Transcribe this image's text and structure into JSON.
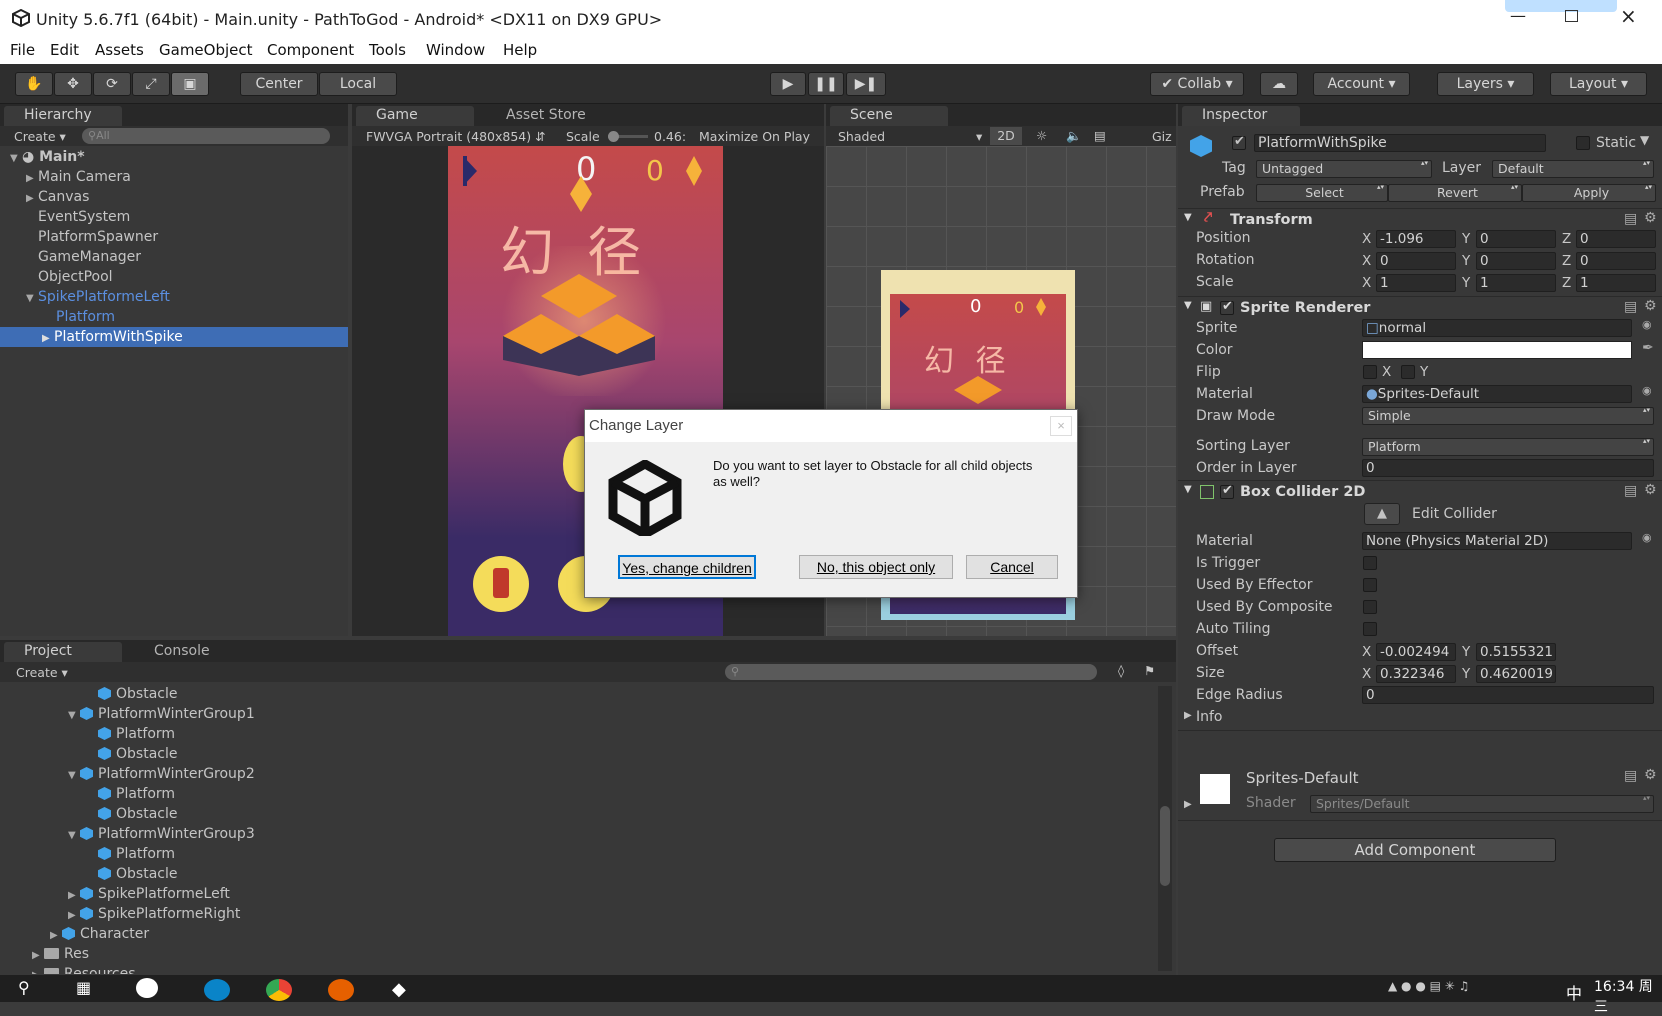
{
  "titlebar": {
    "title": "Unity 5.6.7f1 (64bit) - Main.unity - PathToGod - Android* <DX11 on DX9 GPU>"
  },
  "menu": [
    "File",
    "Edit",
    "Assets",
    "GameObject",
    "Component",
    "Tools",
    "Window",
    "Help"
  ],
  "toolbar": {
    "center": "Center",
    "local": "Local",
    "collab": "Collab",
    "account": "Account",
    "layers": "Layers",
    "layout": "Layout"
  },
  "hierarchy": {
    "tab": "Hierarchy",
    "create": "Create",
    "search": "All",
    "scene": "Main*",
    "items": [
      "Main Camera",
      "Canvas",
      "EventSystem",
      "PlatformSpawner",
      "GameManager",
      "ObjectPool",
      "SpikePlatformeLeft",
      "Platform",
      "PlatformWithSpike"
    ]
  },
  "game": {
    "tab": "Game",
    "tab2": "Asset Store",
    "resolution": "FWVGA Portrait (480x854)",
    "scale_label": "Scale",
    "scale_value": "0.46:",
    "maximize": "Maximize On Play",
    "score": "0",
    "gems": "0",
    "title_cn": "幻 径"
  },
  "scene": {
    "tab": "Scene",
    "shaded": "Shaded",
    "mode2d": "2D",
    "giz": "Giz",
    "score": "0",
    "gems": "0",
    "title_cn": "幻 径"
  },
  "inspector": {
    "tab": "Inspector",
    "name": "PlatformWithSpike",
    "static": "Static",
    "tag_label": "Tag",
    "tag": "Untagged",
    "layer_label": "Layer",
    "layer": "Default",
    "prefab_label": "Prefab",
    "select": "Select",
    "revert": "Revert",
    "apply": "Apply",
    "transform": {
      "title": "Transform",
      "position": "Position",
      "rotation": "Rotation",
      "scale": "Scale",
      "pos": [
        "-1.096",
        "0",
        "0"
      ],
      "rot": [
        "0",
        "0",
        "0"
      ],
      "scl": [
        "1",
        "1",
        "1"
      ]
    },
    "sprite_renderer": {
      "title": "Sprite Renderer",
      "sprite_label": "Sprite",
      "sprite": "normal",
      "color_label": "Color",
      "flip_label": "Flip",
      "flip_x": "X",
      "flip_y": "Y",
      "material_label": "Material",
      "material": "Sprites-Default",
      "draw_mode_label": "Draw Mode",
      "draw_mode": "Simple",
      "sorting_label": "Sorting Layer",
      "sorting": "Platform",
      "order_label": "Order in Layer",
      "order": "0"
    },
    "box_collider": {
      "title": "Box Collider 2D",
      "edit": "Edit Collider",
      "material_label": "Material",
      "material": "None (Physics Material 2D)",
      "trigger": "Is Trigger",
      "effector": "Used By Effector",
      "composite": "Used By Composite",
      "tiling": "Auto Tiling",
      "offset_label": "Offset",
      "offset_x": "-0.002494",
      "offset_y": "0.5155321",
      "size_label": "Size",
      "size_x": "0.322346",
      "size_y": "0.4620019",
      "edge_label": "Edge Radius",
      "edge": "0",
      "info": "Info"
    },
    "material": {
      "name": "Sprites-Default",
      "shader_label": "Shader",
      "shader": "Sprites/Default"
    },
    "add_component": "Add Component"
  },
  "project": {
    "tab": "Project",
    "tab2": "Console",
    "create": "Create",
    "items": [
      {
        "label": "Obstacle",
        "indent": 4,
        "kind": "cube",
        "arrow": ""
      },
      {
        "label": "PlatformWinterGroup1",
        "indent": 3,
        "kind": "cube",
        "arrow": "down"
      },
      {
        "label": "Platform",
        "indent": 4,
        "kind": "cube",
        "arrow": ""
      },
      {
        "label": "Obstacle",
        "indent": 4,
        "kind": "cube",
        "arrow": ""
      },
      {
        "label": "PlatformWinterGroup2",
        "indent": 3,
        "kind": "cube",
        "arrow": "down"
      },
      {
        "label": "Platform",
        "indent": 4,
        "kind": "cube",
        "arrow": ""
      },
      {
        "label": "Obstacle",
        "indent": 4,
        "kind": "cube",
        "arrow": ""
      },
      {
        "label": "PlatformWinterGroup3",
        "indent": 3,
        "kind": "cube",
        "arrow": "down"
      },
      {
        "label": "Platform",
        "indent": 4,
        "kind": "cube",
        "arrow": ""
      },
      {
        "label": "Obstacle",
        "indent": 4,
        "kind": "cube",
        "arrow": ""
      },
      {
        "label": "SpikePlatformeLeft",
        "indent": 3,
        "kind": "cube",
        "arrow": "right"
      },
      {
        "label": "SpikePlatformeRight",
        "indent": 3,
        "kind": "cube",
        "arrow": "right"
      },
      {
        "label": "Character",
        "indent": 2,
        "kind": "cube",
        "arrow": "right"
      },
      {
        "label": "Res",
        "indent": 1,
        "kind": "folder",
        "arrow": "right"
      },
      {
        "label": "Resources",
        "indent": 1,
        "kind": "folder",
        "arrow": "right"
      }
    ]
  },
  "dialog": {
    "title": "Change Layer",
    "message": "Do you want to set layer to Obstacle for all child objects as well?",
    "yes": "Yes, change children",
    "no": "No, this object only",
    "cancel": "Cancel"
  },
  "taskbar": {
    "time": "16:34 周三",
    "lang": "中"
  },
  "colors": {
    "accent": "#3e6db5",
    "unity_blue": "#43a3e8",
    "game_bg_top": "#c44a4a",
    "game_bg_bottom": "#3a2b66"
  }
}
